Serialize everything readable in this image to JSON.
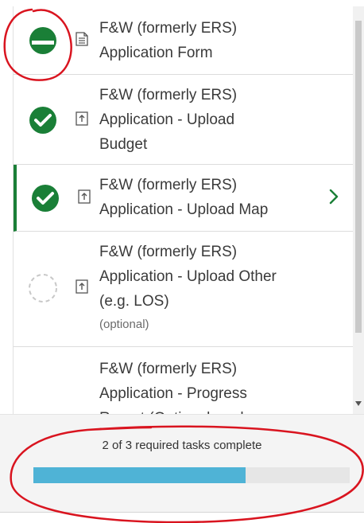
{
  "tasks": [
    {
      "line1": "F&W (formerly ERS)",
      "line2": "Application Form",
      "status": "partial",
      "doc_icon": "document-icon"
    },
    {
      "line1": "F&W (formerly ERS)",
      "line2": "Application - Upload",
      "line3": "Budget",
      "status": "complete",
      "doc_icon": "upload-icon"
    },
    {
      "line1": "F&W (formerly ERS)",
      "line2": "Application - Upload Map",
      "status": "complete",
      "doc_icon": "upload-icon",
      "active": true
    },
    {
      "line1": "F&W (formerly ERS)",
      "line2": "Application - Upload Other",
      "line3": "(e.g. LOS)",
      "optional": "(optional)",
      "status": "not-started",
      "doc_icon": "upload-icon"
    },
    {
      "line1": "F&W (formerly ERS)",
      "line2": "Application - Progress",
      "line3": "Report (Optional - only",
      "status": "not-started",
      "doc_icon": "upload-icon"
    }
  ],
  "progress": {
    "label": "2 of 3 required tasks complete",
    "completed": 2,
    "total": 3,
    "fraction": 0.67
  },
  "colors": {
    "complete": "#1a7f37",
    "progress": "#4fb3d6",
    "annotation": "#d9141f"
  }
}
